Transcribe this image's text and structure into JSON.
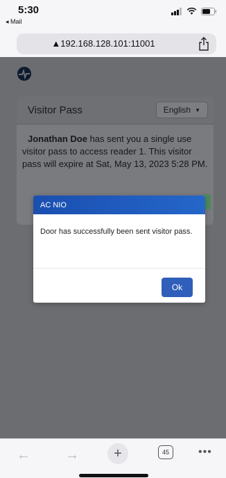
{
  "status_bar": {
    "time": "5:30",
    "back_app": "◂ Mail"
  },
  "browser": {
    "address": "192.168.128.101:11001"
  },
  "visitor_pass": {
    "title": "Visitor Pass",
    "language": "English",
    "sender_name": "Jonathan Doe",
    "message": " has sent you a single use visitor pass to access reader 1. This visitor pass will expire at Sat, May 13, 2023 5:28 PM."
  },
  "modal": {
    "title": "AC NIO",
    "message": "Door has successfully been sent visitor pass.",
    "ok_label": "Ok"
  },
  "toolbar": {
    "back_icon": "←",
    "forward_icon": "→",
    "new_tab_icon": "+",
    "tab_count": "45",
    "more_icon": "•••"
  },
  "colors": {
    "modal_header": "#2566c9",
    "ok_button": "#2f5fba",
    "page_overlay": "#6b6d71"
  }
}
